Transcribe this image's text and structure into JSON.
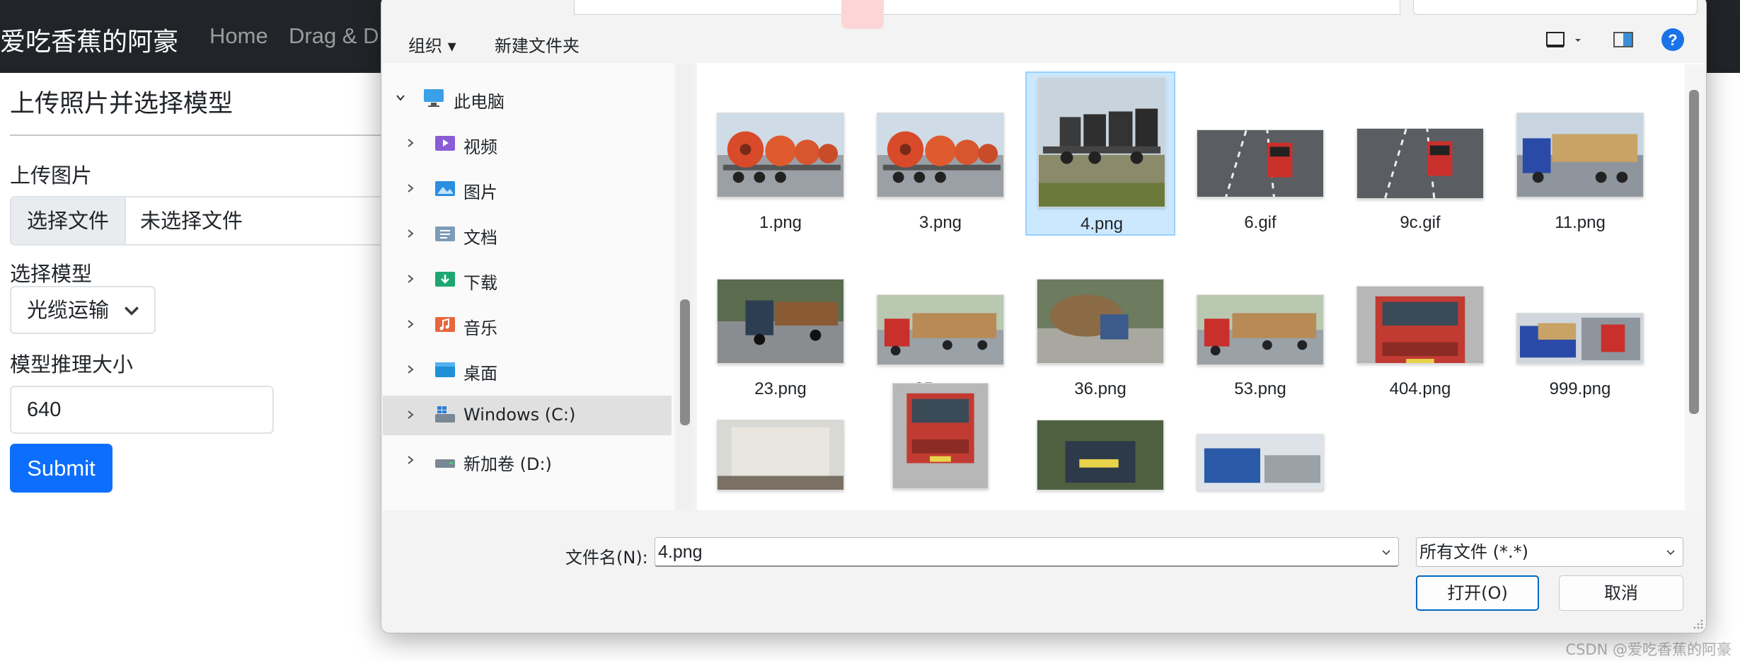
{
  "page": {
    "brand": "爱吃香蕉的阿豪",
    "nav": [
      "Home",
      "Drag & D"
    ],
    "form_title": "上传照片并选择模型",
    "upload_label": "上传图片",
    "file_button": "选择文件",
    "file_status": "未选择文件",
    "model_label": "选择模型",
    "model_value": "光缆运输",
    "size_label": "模型推理大小",
    "size_value": "640",
    "submit_label": "Submit",
    "watermark": "CSDN @爱吃香蕉的阿豪"
  },
  "dialog": {
    "toolbar": {
      "organize": "组织",
      "new_folder": "新建文件夹"
    },
    "tree": [
      {
        "label": "此电脑",
        "icon": "monitor-icon",
        "expanded": true
      },
      {
        "label": "视频",
        "icon": "video-folder-icon"
      },
      {
        "label": "图片",
        "icon": "pictures-folder-icon"
      },
      {
        "label": "文档",
        "icon": "documents-folder-icon"
      },
      {
        "label": "下载",
        "icon": "downloads-folder-icon"
      },
      {
        "label": "音乐",
        "icon": "music-folder-icon"
      },
      {
        "label": "桌面",
        "icon": "desktop-folder-icon"
      },
      {
        "label": "Windows (C:)",
        "icon": "windows-drive-icon",
        "selected": true
      },
      {
        "label": "新加卷 (D:)",
        "icon": "drive-icon"
      }
    ],
    "files": [
      {
        "name": "1.png",
        "scene": "cable-reels"
      },
      {
        "name": "3.png",
        "scene": "cable-reels"
      },
      {
        "name": "4.png",
        "scene": "dark-reels",
        "selected": true
      },
      {
        "name": "6.gif",
        "scene": "road-truck"
      },
      {
        "name": "9c.gif",
        "scene": "road-truck"
      },
      {
        "name": "11.png",
        "scene": "blue-truck-logs"
      },
      {
        "name": "23.png",
        "scene": "log-truck"
      },
      {
        "name": "25.png",
        "scene": "red-log-truck"
      },
      {
        "name": "36.png",
        "scene": "logs-road"
      },
      {
        "name": "53.png",
        "scene": "red-log-truck"
      },
      {
        "name": "404.png",
        "scene": "red-truck-front"
      },
      {
        "name": "999.png",
        "scene": "collage"
      },
      {
        "name": "",
        "scene": "cargo"
      },
      {
        "name": "",
        "scene": "red-truck-front"
      },
      {
        "name": "",
        "scene": "forest-logs"
      },
      {
        "name": "",
        "scene": "blue-truck"
      }
    ],
    "filename_label": "文件名(N):",
    "filename_value": "4.png",
    "filetype_value": "所有文件 (*.*)",
    "open_button": "打开(O)",
    "cancel_button": "取消",
    "accent": "#0067c0"
  }
}
